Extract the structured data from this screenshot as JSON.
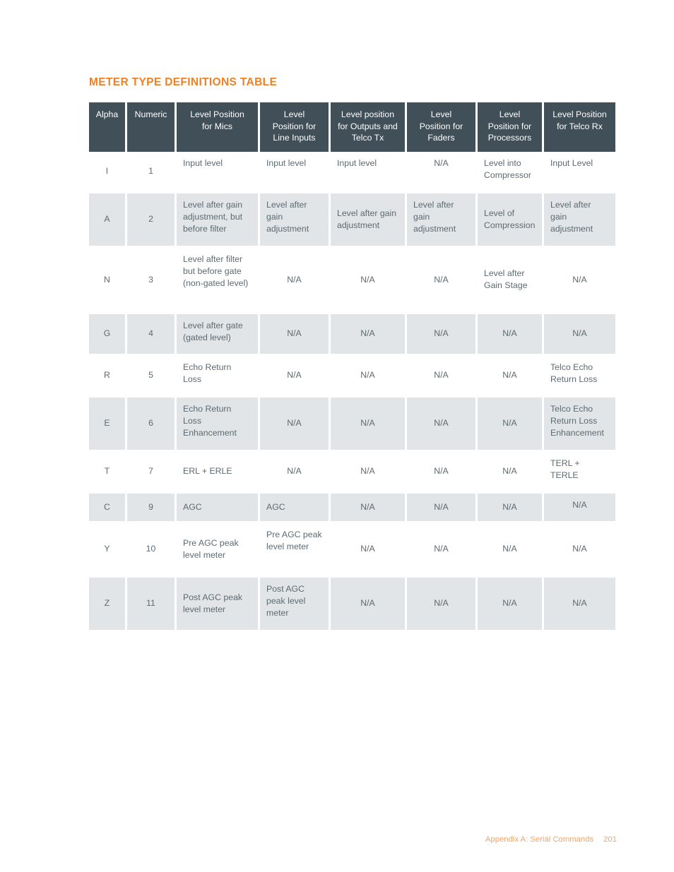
{
  "page": {
    "title": "METER TYPE DEFINITIONS TABLE",
    "accent_color": "#ef8024",
    "header_bg_color": "#414f59",
    "row_shade_color": "#e2e5e7",
    "body_text_color": "#5d6a72"
  },
  "table": {
    "headers": [
      "Alpha",
      "Numeric",
      "Level Position\nfor Mics",
      "Level\nPosition for\nLine Inputs",
      "Level position\nfor Outputs and\nTelco Tx",
      "Level\nPosition for\nFaders",
      "Level\nPosition for\nProcessors",
      "Level Position\nfor Telco Rx"
    ],
    "headers_flat": [
      "Alpha",
      "Numeric",
      "Level Position for Mics",
      "Level Position for Line Inputs",
      "Level position for Outputs and Telco Tx",
      "Level Position for Faders",
      "Level Position for Processors",
      "Level Position for Telco Rx"
    ],
    "rows": [
      {
        "alpha": "I",
        "numeric": "1",
        "mics": "Input level",
        "line_inputs": "Input level",
        "outputs_telco_tx": "Input level",
        "faders": "N/A",
        "processors": "Level into Compressor",
        "telco_rx": "Input Level"
      },
      {
        "alpha": "A",
        "numeric": "2",
        "mics": "Level after gain adjustment, but before filter",
        "line_inputs": "Level after gain adjustment",
        "outputs_telco_tx": "Level after gain adjustment",
        "faders": "Level after gain adjustment",
        "processors": "Level of Compression",
        "telco_rx": "Level after gain adjustment"
      },
      {
        "alpha": "N",
        "numeric": "3",
        "mics": "Level after filter but before gate (non-gated level)",
        "line_inputs": "N/A",
        "outputs_telco_tx": "N/A",
        "faders": "N/A",
        "processors": "Level after Gain Stage",
        "telco_rx": "N/A"
      },
      {
        "alpha": "G",
        "numeric": "4",
        "mics": "Level after gate (gated level)",
        "line_inputs": "N/A",
        "outputs_telco_tx": "N/A",
        "faders": "N/A",
        "processors": "N/A",
        "telco_rx": "N/A"
      },
      {
        "alpha": "R",
        "numeric": "5",
        "mics": "Echo Return Loss",
        "line_inputs": "N/A",
        "outputs_telco_tx": "N/A",
        "faders": "N/A",
        "processors": "N/A",
        "telco_rx": "Telco Echo Return Loss"
      },
      {
        "alpha": "E",
        "numeric": "6",
        "mics": "Echo Return Loss Enhancement",
        "line_inputs": "N/A",
        "outputs_telco_tx": "N/A",
        "faders": "N/A",
        "processors": "N/A",
        "telco_rx": "Telco Echo Return Loss Enhancement"
      },
      {
        "alpha": "T",
        "numeric": "7",
        "mics": "ERL + ERLE",
        "line_inputs": "N/A",
        "outputs_telco_tx": "N/A",
        "faders": "N/A",
        "processors": "N/A",
        "telco_rx": "TERL + TERLE"
      },
      {
        "alpha": "C",
        "numeric": "9",
        "mics": "AGC",
        "line_inputs": "AGC",
        "outputs_telco_tx": "N/A",
        "faders": "N/A",
        "processors": "N/A",
        "telco_rx": "N/A"
      },
      {
        "alpha": "Y",
        "numeric": "10",
        "mics": "Pre AGC peak level meter",
        "line_inputs": "Pre AGC peak level meter",
        "outputs_telco_tx": "N/A",
        "faders": "N/A",
        "processors": "N/A",
        "telco_rx": "N/A"
      },
      {
        "alpha": "Z",
        "numeric": "11",
        "mics": "Post AGC peak level meter",
        "line_inputs": "Post AGC peak level meter",
        "outputs_telco_tx": "N/A",
        "faders": "N/A",
        "processors": "N/A",
        "telco_rx": "N/A"
      }
    ]
  },
  "footer": {
    "label": "Appendix A: Serial Commands",
    "page_number": "201"
  }
}
